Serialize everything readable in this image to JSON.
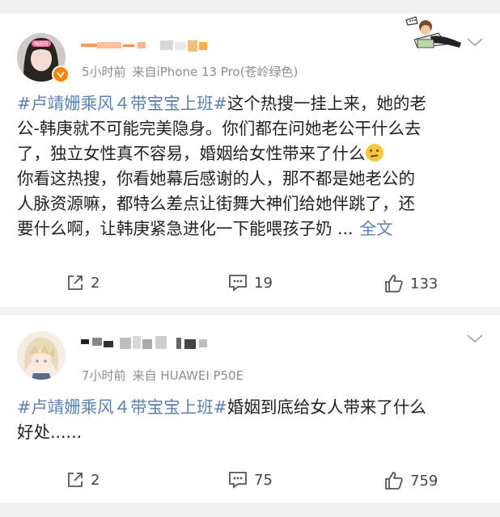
{
  "posts": [
    {
      "time": "5小时前",
      "source": "来自iPhone 13 Pro(苍岭绿色)",
      "avatar_sticker": "嗨我呀",
      "hashtag": "#卢靖姗乘风４带宝宝上班#",
      "text_lines": [
        "这个热搜一挂上来，她的老",
        "公-韩庚就不可能完美隐身。你们都在问她老公干什么去",
        "了，独立女性真不容易，婚姻给女性带来了什么",
        "你看这热搜，你看她幕后感谢的人，那不都是她老公的",
        "人脉资源嘛，都特么差点让街舞大神们给她伴跳了，还",
        "要什么啊，让韩庚紧急进化一下能喂孩子奶 ..."
      ],
      "more_label": "全文",
      "repost_count": "2",
      "comment_count": "19",
      "like_count": "133"
    },
    {
      "time": "7小时前",
      "source": "来自 HUAWEI P50E",
      "hashtag": "#卢靖姗乘风４带宝宝上班#",
      "text_lines": [
        "婚姻到底给女人带来了什么",
        "好处......"
      ],
      "repost_count": "2",
      "comment_count": "75",
      "like_count": "759"
    }
  ],
  "colors": {
    "link": "#5b7fb3",
    "meta": "#8d8d8d",
    "badge": "#ff8200"
  },
  "icons": [
    "repost-icon",
    "comment-icon",
    "like-icon",
    "chevron-down-icon",
    "verified-badge-icon",
    "thinking-emoji-icon"
  ]
}
